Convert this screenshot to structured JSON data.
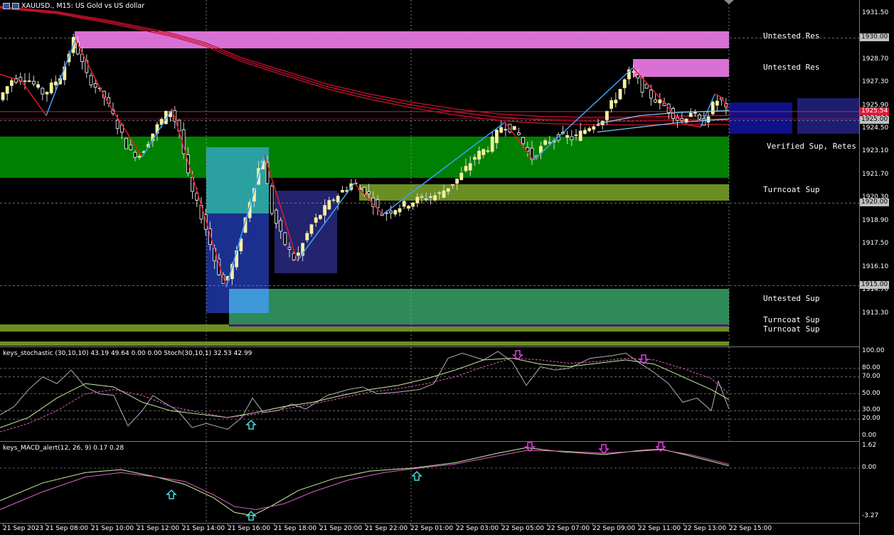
{
  "symbol_title": "XAUUSD., M15: US Gold vs US dollar",
  "main_ticks": [
    "1931.50",
    "1930.00",
    "1928.70",
    "1927.30",
    "1925.90",
    "1925.30",
    "1925.00",
    "1924.50",
    "1923.10",
    "1921.70",
    "1920.30",
    "1920.00",
    "1918.90",
    "1917.50",
    "1916.10",
    "1915.00",
    "1914.70",
    "1913.30"
  ],
  "main_tick_values": [
    1931.5,
    1930.0,
    1928.7,
    1927.3,
    1925.9,
    1925.3,
    1925.0,
    1924.5,
    1923.1,
    1921.7,
    1920.3,
    1920.0,
    1918.9,
    1917.5,
    1916.1,
    1915.0,
    1914.7,
    1913.3
  ],
  "boxed_ticks": [
    {
      "label": "1930.00",
      "value": 1930.0,
      "bg": "#c0c0c0",
      "fg": "#000000"
    },
    {
      "label": "1925.54",
      "value": 1925.54,
      "bg": "#d81e3a",
      "fg": "#ffffff"
    },
    {
      "label": "1925.00",
      "value": 1925.0,
      "bg": "#c0c0c0",
      "fg": "#000000"
    },
    {
      "label": "1920.00",
      "value": 1920.0,
      "bg": "#c0c0c0",
      "fg": "#000000"
    },
    {
      "label": "1915.00",
      "value": 1915.0,
      "bg": "#c0c0c0",
      "fg": "#000000"
    }
  ],
  "zones": [
    {
      "label": "Untested Res",
      "price": 1930.1
    },
    {
      "label": "Untested Res",
      "price": 1928.2
    },
    {
      "label": "Verified Sup, Retes",
      "price": 1923.4
    },
    {
      "label": "Turncoat Sup",
      "price": 1920.8
    },
    {
      "label": "Untested Sup",
      "price": 1914.2
    },
    {
      "label": "Turncoat Sup",
      "price": 1912.9
    },
    {
      "label": "Turncoat Sup",
      "price": 1912.35
    }
  ],
  "stoch_label": "keys_stochastic (30,10,10) 43.19 49.64 0.00 0.00 Stoch(30,10,1) 32.53 42.99",
  "stoch_ticks": [
    "100.00",
    "80.00",
    "70.00",
    "50.00",
    "30.00",
    "20.00",
    "0.00"
  ],
  "macd_label": "keys_MACD_alert(12, 26, 9) 0.17 0.28",
  "macd_ticks": [
    "1.62",
    "0.00",
    "-3.27"
  ],
  "time_labels": [
    "21 Sep 2023",
    "21 Sep 08:00",
    "21 Sep 10:00",
    "21 Sep 12:00",
    "21 Sep 14:00",
    "21 Sep 16:00",
    "21 Sep 18:00",
    "21 Sep 20:00",
    "21 Sep 22:00",
    "22 Sep 01:00",
    "22 Sep 03:00",
    "22 Sep 05:00",
    "22 Sep 07:00",
    "22 Sep 09:00",
    "22 Sep 11:00",
    "22 Sep 13:00",
    "22 Sep 15:00"
  ],
  "colors": {
    "bull": "#f5f0a0",
    "bear": "#ffffff",
    "zigzag_up": "#3fa0ff",
    "zigzag_down": "#e01a2a",
    "ma": "#c8102e",
    "res": "#da70d6",
    "sup": "#008000",
    "turncoat": "#6b8e23",
    "untested_sup": "#2e8b57"
  }
}
